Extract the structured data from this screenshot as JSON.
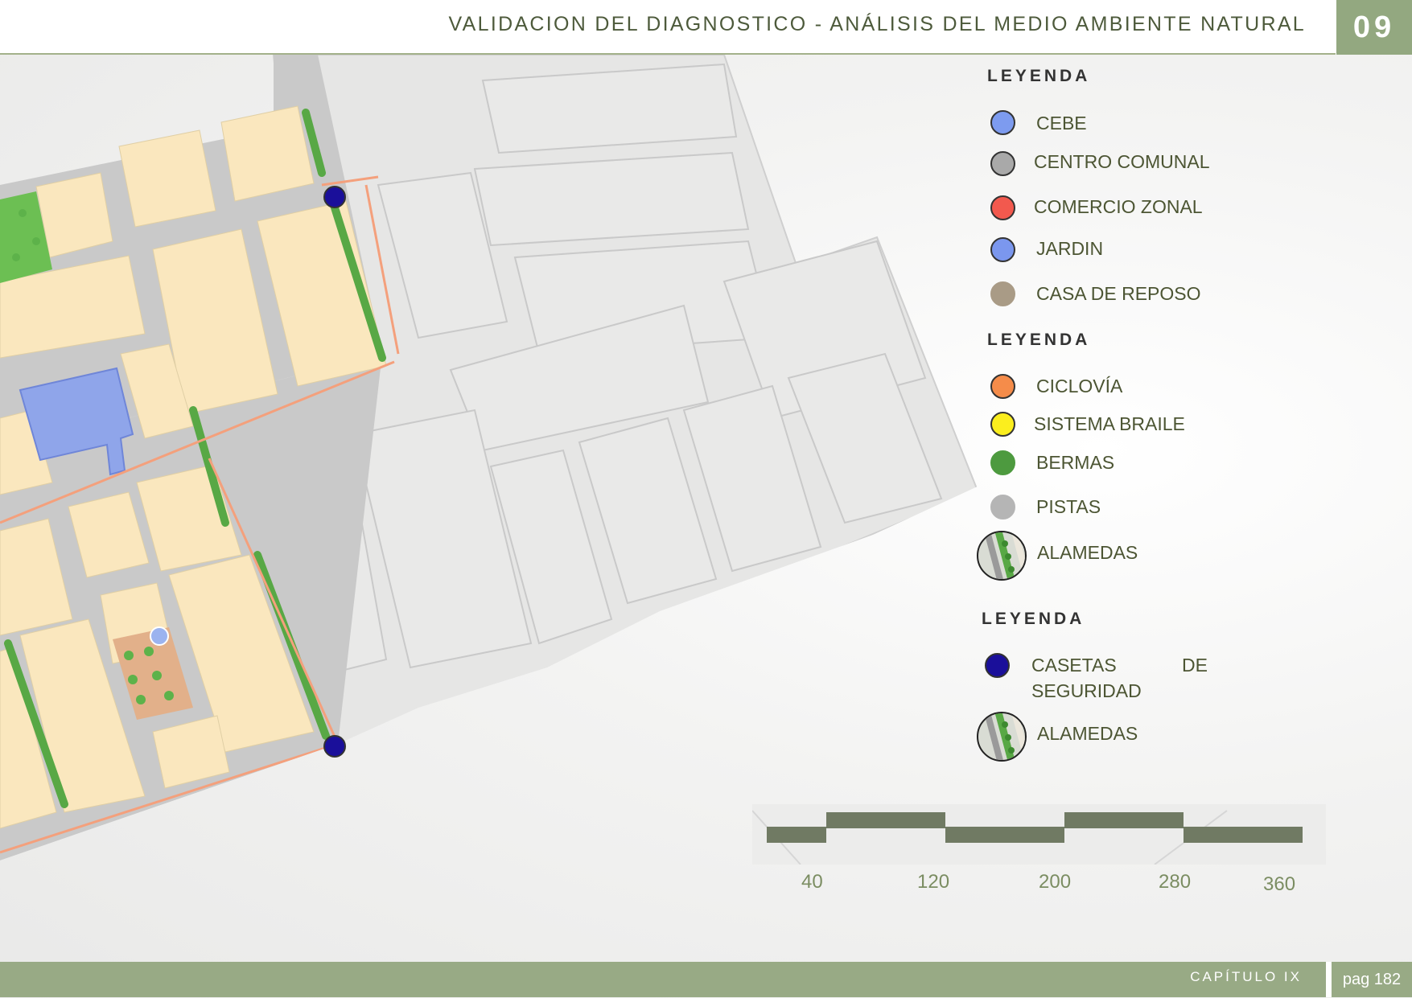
{
  "header": {
    "title": "VALIDACION DEL DIAGNOSTICO - ANÁLISIS DEL MEDIO AMBIENTE NATURAL",
    "chapter_number": "09"
  },
  "legend_1": {
    "title": "LEYENDA",
    "items": [
      {
        "label": "CEBE",
        "color": "#7d9bef"
      },
      {
        "label": "CENTRO COMUNAL",
        "color": "#a9a9a9"
      },
      {
        "label": "COMERCIO ZONAL",
        "color": "#f2594e"
      },
      {
        "label": "JARDIN",
        "color": "#7b97ee"
      },
      {
        "label": "CASA DE REPOSO",
        "color": "#a99b86"
      }
    ]
  },
  "legend_2": {
    "title": "LEYENDA",
    "items": [
      {
        "label": "CICLOVÍA",
        "color": "#f58c4a"
      },
      {
        "label": "SISTEMA BRAILE",
        "color": "#fbee1e"
      },
      {
        "label": "BERMAS",
        "color": "#4d9a3f"
      },
      {
        "label": "PISTAS",
        "color": "#b5b5b5"
      },
      {
        "label": "ALAMEDAS",
        "icon": "alameda-icon"
      }
    ]
  },
  "legend_3": {
    "title": "LEYENDA",
    "items": [
      {
        "label_line1": "CASETAS",
        "label_line1b": "DE",
        "label_line2": "SEGURIDAD",
        "color": "#1a0f9a"
      },
      {
        "label": "ALAMEDAS",
        "icon": "alameda-icon"
      }
    ]
  },
  "scale_bar": {
    "labels": [
      "40",
      "120",
      "200",
      "280",
      "360"
    ]
  },
  "footer": {
    "chapter_label": "CAPÍTULO IX",
    "page_label": "pag 182"
  }
}
